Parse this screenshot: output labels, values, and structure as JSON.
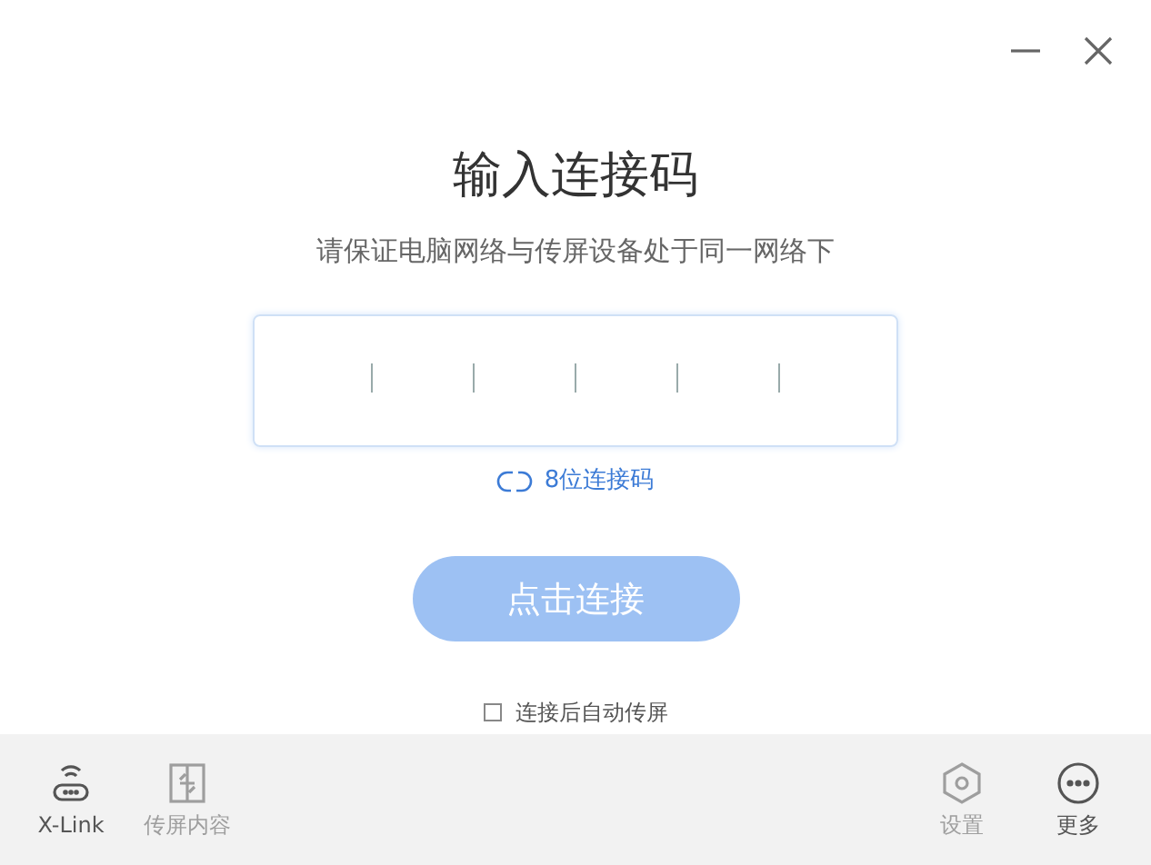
{
  "window": {
    "controls": [
      {
        "kind": "minimize"
      },
      {
        "kind": "close"
      }
    ]
  },
  "title": "输入连接码",
  "subtitle": "请保证电脑网络与传屏设备处于同一网络下",
  "code_mode_link": "8位连接码",
  "connect_button": {
    "label": "点击连接",
    "disabled": true
  },
  "auto_cast": {
    "label": "连接后自动传屏",
    "checked": false
  },
  "bottom_bar": {
    "left": [
      {
        "kind": "router",
        "label": "X-Link",
        "disabled": false
      },
      {
        "kind": "cast",
        "label": "传屏内容",
        "disabled": true
      }
    ],
    "right": [
      {
        "kind": "settings",
        "label": "设置",
        "disabled": true
      },
      {
        "kind": "more",
        "label": "更多",
        "disabled": false
      }
    ]
  }
}
